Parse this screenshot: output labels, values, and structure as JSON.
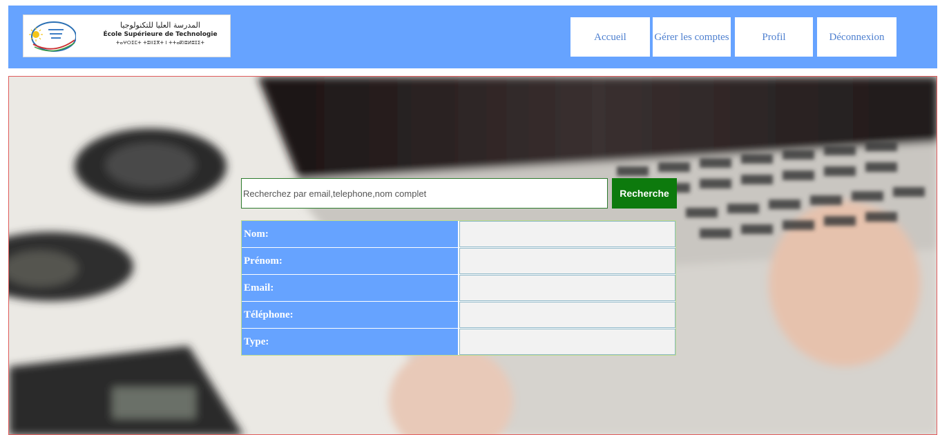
{
  "header": {
    "logo": {
      "arabic": "المدرسة العليا للتكنولوجيا",
      "latin": "École Supérieure de Technologie",
      "tifinagh": "ⵜⴰⵖⵔⵉⵎⵜ ⵜⵓⵏⵏⵉⴳⵜ ⵏ ⵜⵜⴰⴽⵏⵓⵍⵓⵊⵉⵜ"
    },
    "nav": [
      {
        "label": "Accueil"
      },
      {
        "label": "Gérer les comptes"
      },
      {
        "label": "Profil"
      },
      {
        "label": "Déconnexion"
      }
    ]
  },
  "search": {
    "placeholder": "Recherchez par email,telephone,nom complet",
    "value": "",
    "button_label": "Recherche"
  },
  "table": {
    "rows": [
      {
        "label": "Nom:",
        "value": ""
      },
      {
        "label": "Prénom:",
        "value": ""
      },
      {
        "label": "Email:",
        "value": ""
      },
      {
        "label": "Téléphone:",
        "value": ""
      },
      {
        "label": "Type:",
        "value": ""
      }
    ]
  },
  "colors": {
    "header_bg": "#66a3ff",
    "nav_text": "#4d7fcf",
    "search_button_bg": "#0d7a0d",
    "table_label_bg": "#66a3ff",
    "hero_border": "#e05a5a"
  }
}
